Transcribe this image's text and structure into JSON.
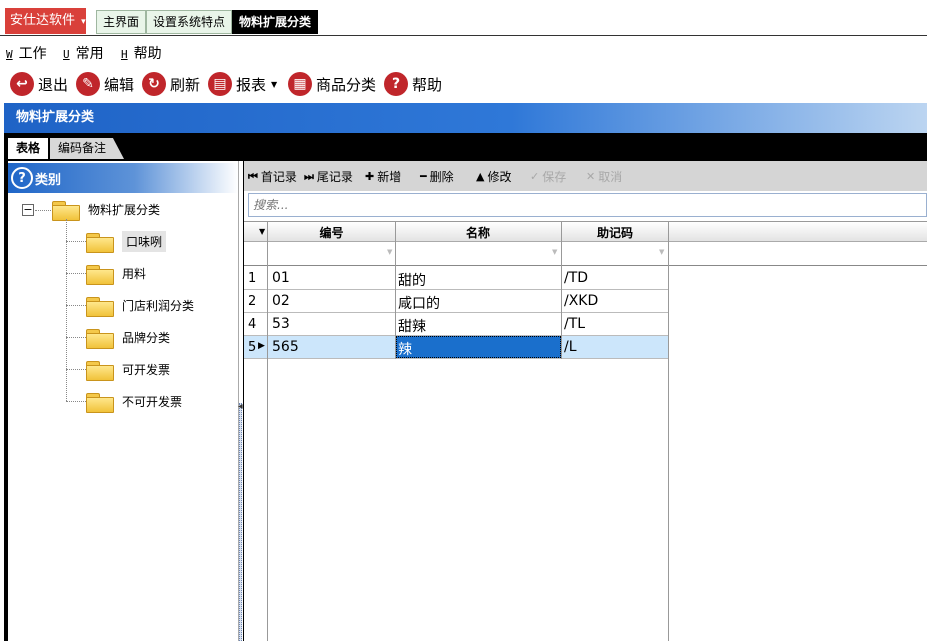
{
  "app_menu": {
    "label": "安仕达软件",
    "arrow": "▾"
  },
  "doc_tabs": [
    "主界面",
    "设置系统特点",
    "物料扩展分类"
  ],
  "menu": [
    {
      "key": "W",
      "label": "工作"
    },
    {
      "key": "U",
      "label": "常用"
    },
    {
      "key": "H",
      "label": "帮助"
    }
  ],
  "toolbar": {
    "exit": "退出",
    "edit": "编辑",
    "refresh": "刷新",
    "report": "报表",
    "category": "商品分类",
    "help": "帮助"
  },
  "window_title": "物料扩展分类",
  "sub_tabs": [
    "表格",
    "编码备注"
  ],
  "tree": {
    "header": "类别",
    "expand_symbol": "−",
    "root": "物料扩展分类",
    "children": [
      "口味咧",
      "用料",
      "门店利润分类",
      "品牌分类",
      "可开发票",
      "不可开发票"
    ],
    "selected_index": 0
  },
  "grid_toolbar": {
    "first": "首记录",
    "last": "尾记录",
    "add": "新增",
    "delete": "删除",
    "modify": "修改",
    "save": "保存",
    "cancel": "取消"
  },
  "search": {
    "placeholder": "搜索..."
  },
  "table": {
    "columns": [
      "编号",
      "名称",
      "助记码"
    ],
    "rows": [
      {
        "num": "1",
        "code": "01",
        "name": "甜的",
        "mnemonic": "/TD"
      },
      {
        "num": "2",
        "code": "02",
        "name": "咸口的",
        "mnemonic": "/XKD"
      },
      {
        "num": "4",
        "code": "53",
        "name": "甜辣",
        "mnemonic": "/TL"
      },
      {
        "num": "5",
        "code": "565",
        "name": "辣",
        "mnemonic": "/L"
      }
    ],
    "current_row": 3
  },
  "colors": {
    "accent_red": "#d9403a",
    "title_blue": "#1f63c6",
    "selection": "#1a6fcc"
  }
}
